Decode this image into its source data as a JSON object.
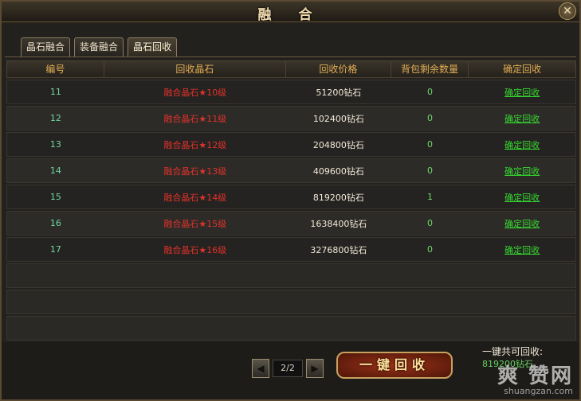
{
  "window": {
    "title": "融 合",
    "close_glyph": "✕"
  },
  "tabs": [
    {
      "label": "晶石融合",
      "active": false
    },
    {
      "label": "装备融合",
      "active": false
    },
    {
      "label": "晶石回收",
      "active": true
    }
  ],
  "table": {
    "headers": [
      "编号",
      "回收晶石",
      "回收价格",
      "背包剩余数量",
      "确定回收"
    ],
    "rows": [
      {
        "id": "11",
        "name": "融合晶石★10级",
        "price": "51200钻石",
        "count": "0",
        "action": "确定回收"
      },
      {
        "id": "12",
        "name": "融合晶石★11级",
        "price": "102400钻石",
        "count": "0",
        "action": "确定回收"
      },
      {
        "id": "13",
        "name": "融合晶石★12级",
        "price": "204800钻石",
        "count": "0",
        "action": "确定回收"
      },
      {
        "id": "14",
        "name": "融合晶石★13级",
        "price": "409600钻石",
        "count": "0",
        "action": "确定回收"
      },
      {
        "id": "15",
        "name": "融合晶石★14级",
        "price": "819200钻石",
        "count": "1",
        "action": "确定回收"
      },
      {
        "id": "16",
        "name": "融合晶石★15级",
        "price": "1638400钻石",
        "count": "0",
        "action": "确定回收"
      },
      {
        "id": "17",
        "name": "融合晶石★16级",
        "price": "3276800钻石",
        "count": "0",
        "action": "确定回收"
      }
    ]
  },
  "pager": {
    "prev_glyph": "◀",
    "next_glyph": "▶",
    "page": "2/2"
  },
  "one_click_button": "一键回收",
  "summary": {
    "label": "一键共可回收:",
    "value": "819200钻石"
  },
  "watermark": {
    "big": "爽 赞网",
    "small": "shuangzan.com"
  }
}
